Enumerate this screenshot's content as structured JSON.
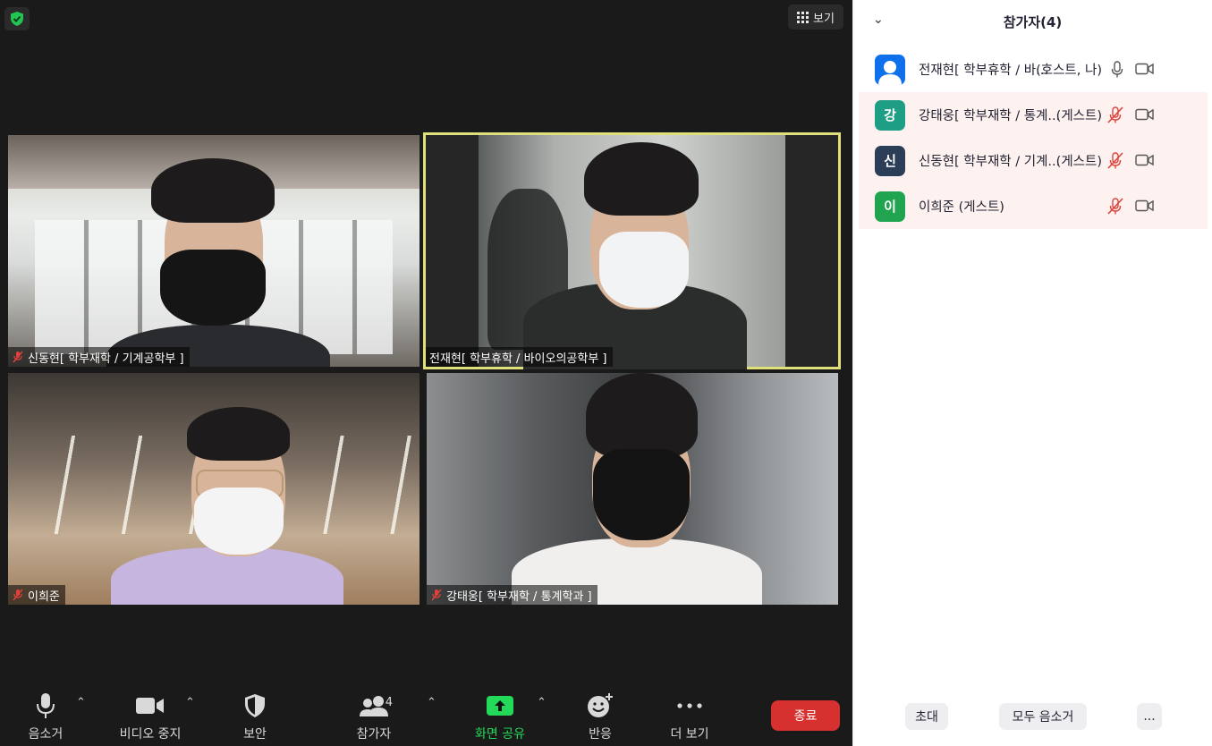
{
  "toolbar_top": {
    "view_label": "보기",
    "view_icon": "grid-icon",
    "security_icon": "shield-check-icon"
  },
  "tiles": [
    {
      "name": "신동현[ 학부재학 / 기계공학부 ]",
      "muted": true
    },
    {
      "name": "전재현[ 학부휴학 / 바이오의공학부 ]",
      "muted": false,
      "active_speaker": true
    },
    {
      "name": "이희준",
      "muted": true
    },
    {
      "name": "강태웅[ 학부재학 / 통계학과 ]",
      "muted": true
    }
  ],
  "toolbar": {
    "mute_label": "음소거",
    "video_label": "비디오 중지",
    "security_label": "보안",
    "participants_label": "참가자",
    "participants_count": "4",
    "share_label": "화면 공유",
    "reactions_label": "반응",
    "more_label": "더 보기",
    "end_label": "종료",
    "share_color": "#23d959",
    "end_color": "#d6312e"
  },
  "panel": {
    "title": "참가자(4)",
    "participants": [
      {
        "initial": "",
        "avatar_color": "#0e71eb",
        "name": "전재현[ 학부휴학 / 바...",
        "role": "(호스트, 나)",
        "mic": "on",
        "highlight": false
      },
      {
        "initial": "강",
        "avatar_color": "#1f9e86",
        "name": "강태웅[ 학부재학 / 통계...",
        "role": "(게스트)",
        "mic": "muted",
        "highlight": true
      },
      {
        "initial": "신",
        "avatar_color": "#2c3e57",
        "name": "신동현[ 학부재학 / 기계...",
        "role": "(게스트)",
        "mic": "muted",
        "highlight": true
      },
      {
        "initial": "이",
        "avatar_color": "#21a44f",
        "name": "이희준 (게스트)",
        "role": "",
        "mic": "muted",
        "highlight": true
      }
    ],
    "invite_label": "초대",
    "mute_all_label": "모두 음소거",
    "more_label": "..."
  }
}
